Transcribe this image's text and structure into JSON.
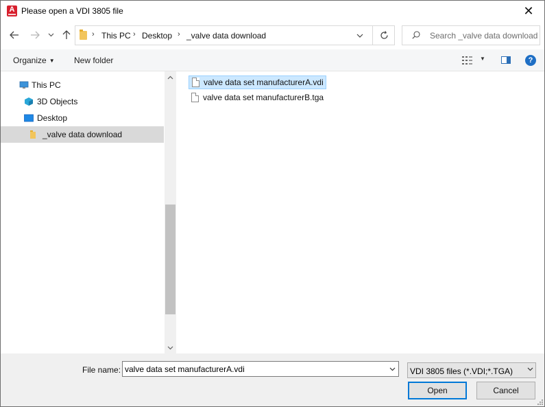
{
  "window": {
    "title": "Please open a VDI 3805 file",
    "app_icon_letter": "A",
    "close_glyph": "✕"
  },
  "navigation": {
    "back_icon": "arrow-left-icon",
    "forward_icon": "arrow-right-icon",
    "recent_icon": "chevron-down-icon",
    "up_icon": "arrow-up-icon"
  },
  "address": {
    "breadcrumbs": [
      "This PC",
      "Desktop",
      "_valve data download"
    ]
  },
  "search": {
    "placeholder": "Search _valve data download"
  },
  "toolbar": {
    "organize_label": "Organize",
    "new_folder_label": "New folder",
    "help_glyph": "?"
  },
  "sidebar": {
    "items": [
      {
        "label": "This PC",
        "icon": "computer-icon"
      },
      {
        "label": "3D Objects",
        "icon": "3d-objects-icon"
      },
      {
        "label": "Desktop",
        "icon": "desktop-icon"
      },
      {
        "label": "_valve data download",
        "icon": "folder-icon",
        "selected": true
      }
    ]
  },
  "files": [
    {
      "name": "valve data set manufacturerA.vdi",
      "selected": true
    },
    {
      "name": "valve data set manufacturerB.tga",
      "selected": false
    }
  ],
  "bottom": {
    "file_name_label": "File name:",
    "file_name_value": "valve data set manufacturerA.vdi",
    "filter_value": "VDI 3805 files (*.VDI;*.TGA)",
    "open_label": "Open",
    "cancel_label": "Cancel"
  },
  "colors": {
    "accent": "#0078d7",
    "selection": "#cce8ff",
    "app_icon": "#d8202e",
    "folder": "#f2c55c"
  }
}
